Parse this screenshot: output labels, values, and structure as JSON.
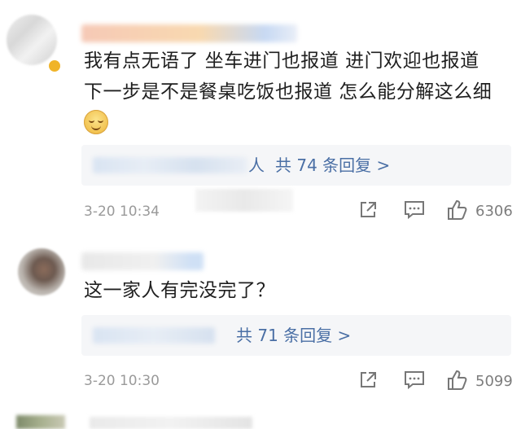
{
  "comments": [
    {
      "text_lines": [
        "我有点无语了 坐车进门也报道 进门欢迎也报道",
        "下一步是不是餐桌吃饭也报道 怎么能分解这么细"
      ],
      "reply_prefix_suffix": "人",
      "reply_label": "共 74 条回复 >",
      "timestamp": "3-20 10:34",
      "likes": "6306",
      "emoji": "smile-emoji"
    },
    {
      "text_lines": [
        "这一家人有完没完了？"
      ],
      "reply_label": "共 71 条回复 >",
      "timestamp": "3-20 10:30",
      "likes": "5099"
    }
  ],
  "icons": {
    "share": "share-icon",
    "comment": "comment-icon",
    "like": "thumbs-up-icon",
    "verified": "verified-badge-icon"
  },
  "colors": {
    "reply_link": "#4a6fa5",
    "timestamp": "#9a9a9a",
    "reply_bg": "#f5f6f8",
    "verified": "#f0b429"
  }
}
